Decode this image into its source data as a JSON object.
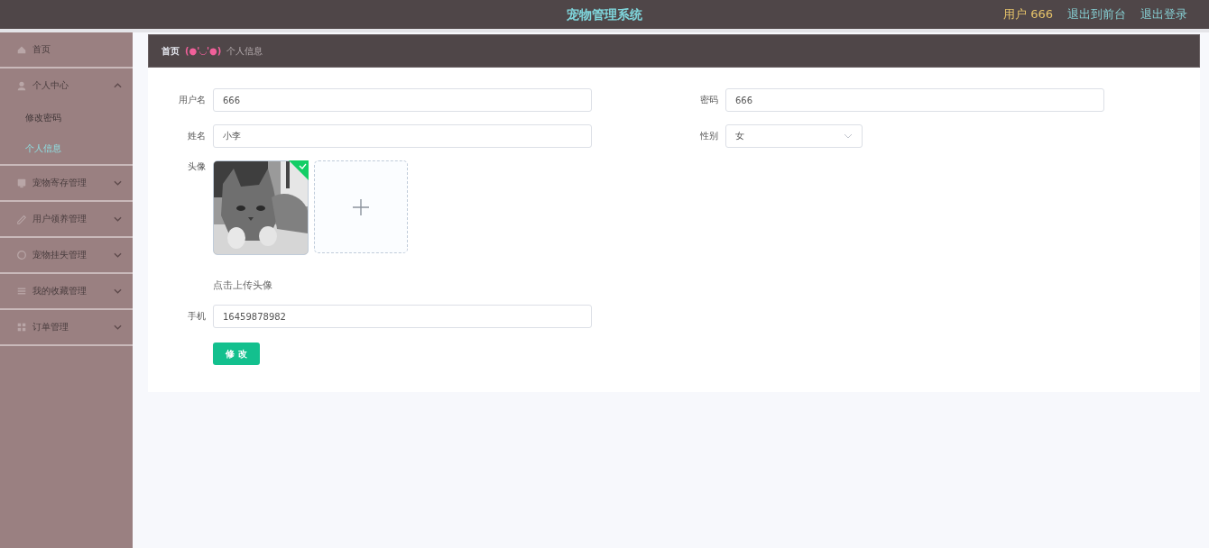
{
  "header": {
    "title": "宠物管理系统",
    "user": "用户 666",
    "links": [
      "退出到前台",
      "退出登录"
    ]
  },
  "sidebar": {
    "items": [
      {
        "kind": "link",
        "label": "首页"
      },
      {
        "kind": "group",
        "label": "个人中心",
        "expanded": true,
        "children": [
          {
            "label": "修改密码",
            "selected": false
          },
          {
            "label": "个人信息",
            "selected": true
          }
        ]
      },
      {
        "kind": "group",
        "label": "宠物寄存管理",
        "expanded": false
      },
      {
        "kind": "group",
        "label": "用户领养管理",
        "expanded": false
      },
      {
        "kind": "group",
        "label": "宠物挂失管理",
        "expanded": false
      },
      {
        "kind": "group",
        "label": "我的收藏管理",
        "expanded": false
      },
      {
        "kind": "group",
        "label": "订单管理",
        "expanded": false
      }
    ]
  },
  "breadcrumb": {
    "home": "首页",
    "separator": "(●'◡'●)",
    "current": "个人信息"
  },
  "form": {
    "fields": [
      {
        "kind": "input",
        "label": "用户名",
        "value": "666"
      },
      {
        "kind": "input",
        "label": "密码",
        "value": "666"
      },
      {
        "kind": "input",
        "label": "姓名",
        "value": "小李"
      },
      {
        "kind": "select",
        "label": "性别",
        "value": "女"
      },
      {
        "kind": "upload",
        "label": "头像",
        "uploaded": true,
        "hint": "点击上传头像"
      },
      {
        "kind": "input",
        "label": "手机",
        "value": "16459878982"
      }
    ],
    "submit": "修 改"
  }
}
